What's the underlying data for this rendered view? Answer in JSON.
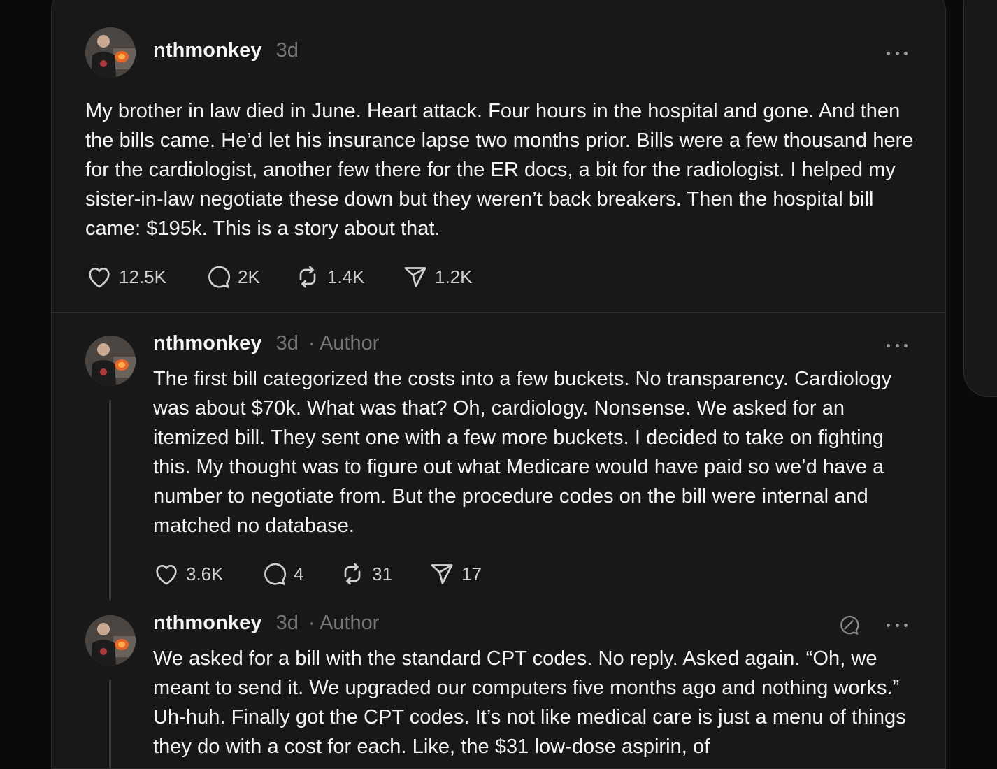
{
  "main_post": {
    "username": "nthmonkey",
    "time": "3d",
    "text": "My brother in law died in June. Heart attack. Four hours in the hospital and gone. And then the bills came. He’d let his insurance lapse two months prior. Bills were a few thousand here for the cardiologist, another few there for the ER docs, a bit for the radiologist. I helped my sister-in-law negotiate these down but they weren’t back breakers. Then the hospital bill came: $195k. This is a story about that.",
    "likes": "12.5K",
    "replies": "2K",
    "reposts": "1.4K",
    "shares": "1.2K"
  },
  "reply_1": {
    "username": "nthmonkey",
    "time": "3d",
    "author_tag": "· Author",
    "text": "The first bill categorized the costs into a few buckets. No transparency. Cardiology was about $70k. What was that? Oh, cardiology. Nonsense. We asked for an itemized bill. They sent one with a few more buckets. I decided to take on fighting this. My thought was to figure out what Medicare would have paid so we’d have a number to negotiate from. But the procedure codes on the bill were internal and matched no database.",
    "likes": "3.6K",
    "replies": "4",
    "reposts": "31",
    "shares": "17"
  },
  "reply_2": {
    "username": "nthmonkey",
    "time": "3d",
    "author_tag": "· Author",
    "text": "We asked for a bill with the standard CPT codes. No reply. Asked again. “Oh, we meant to send it. We upgraded our computers five months ago and nothing works.” Uh-huh. Finally got the CPT codes. It’s not like medical care is just a menu of things they do with a cost for each. Like, the $31 low-dose aspirin, of"
  },
  "icons": [
    "heart-icon",
    "comment-icon",
    "repost-icon",
    "share-icon",
    "more-icon",
    "mute-icon",
    "avatar"
  ],
  "colors": {
    "background": "#0a0a0a",
    "card": "#181818",
    "text": "#f3f5f7",
    "muted": "#777777"
  }
}
